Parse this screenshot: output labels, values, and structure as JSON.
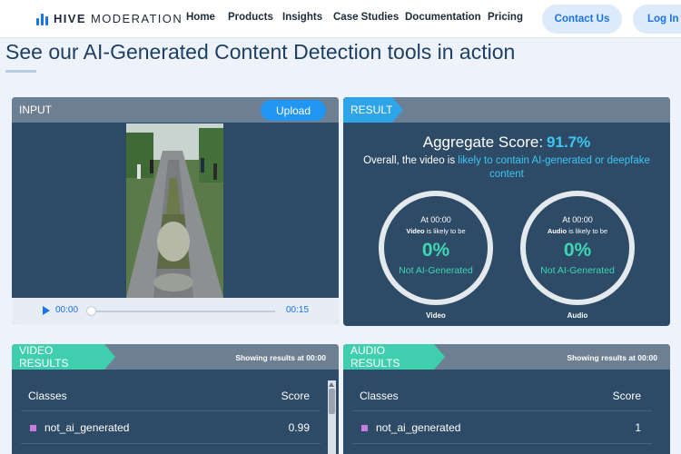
{
  "nav": {
    "logo_bold": "HIVE",
    "logo_light": " MODERATION",
    "links": [
      "Home",
      "Products",
      "Insights",
      "Case Studies",
      "Documentation",
      "Pricing"
    ],
    "contact": "Contact Us",
    "login": "Log In"
  },
  "headline": "See our AI-Generated Content Detection tools in action",
  "input": {
    "title": "INPUT",
    "upload": "Upload",
    "time_current": "00:00",
    "time_total": "00:15",
    "playback_progress": 0
  },
  "result": {
    "tag": "RESULT",
    "aggregate_label": "Aggregate Score:",
    "aggregate_score": "91.7%",
    "overall_prefix": "Overall, the video is ",
    "overall_highlight": "likely to contain AI-generated or deepfake content",
    "video": {
      "time": "At 00:00",
      "likely_bold": "Video",
      "likely_rest": " is likely to be",
      "pct": "0%",
      "label": "Not AI-Generated",
      "caption": "Video"
    },
    "audio": {
      "time": "At 00:00",
      "likely_bold": "Audio",
      "likely_rest": " is likely to be",
      "pct": "0%",
      "label": "Not AI-Generated",
      "caption": "Audio"
    }
  },
  "video_results": {
    "tag": "VIDEO RESULTS",
    "showing_prefix": "Showing results at ",
    "showing_time": "00:00",
    "col_classes": "Classes",
    "col_score": "Score",
    "row_class": "not_ai_generated",
    "row_score": "0.99"
  },
  "audio_results": {
    "tag": "AUDIO RESULTS",
    "showing_prefix": "Showing results at ",
    "showing_time": "00:00",
    "col_classes": "Classes",
    "col_score": "Score",
    "row_class": "not_ai_generated",
    "row_score": "1"
  },
  "colors": {
    "accent_blue": "#2ea5e8",
    "accent_green": "#3fcfae",
    "panel_bg": "#2d4a66"
  }
}
